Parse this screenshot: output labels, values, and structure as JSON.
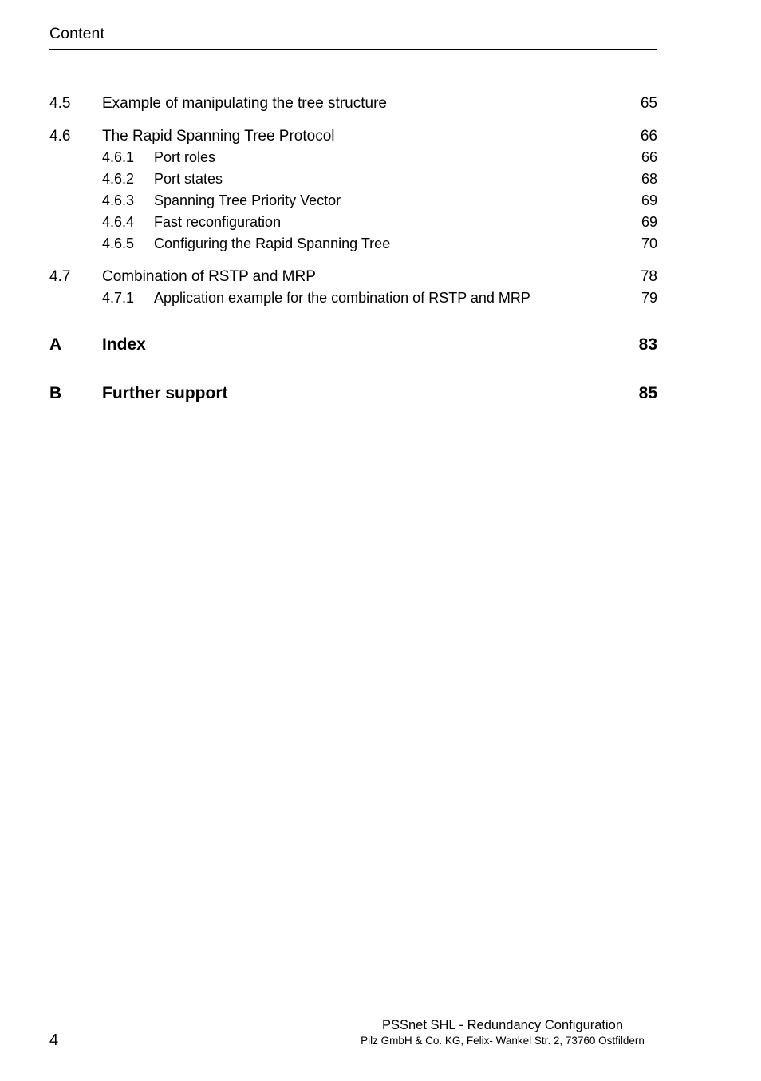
{
  "header": {
    "title": "Content"
  },
  "toc": {
    "entries": [
      {
        "level": 1,
        "number": "4.5",
        "title": "Example of manipulating the tree structure",
        "page": "65"
      },
      {
        "level": 1,
        "number": "4.6",
        "title": "The Rapid Spanning Tree Protocol",
        "page": "66"
      },
      {
        "level": 2,
        "number": "4.6.1",
        "title": "Port roles",
        "page": "66"
      },
      {
        "level": 2,
        "number": "4.6.2",
        "title": "Port states",
        "page": "68"
      },
      {
        "level": 2,
        "number": "4.6.3",
        "title": "Spanning Tree Priority Vector",
        "page": "69"
      },
      {
        "level": 2,
        "number": "4.6.4",
        "title": "Fast reconfiguration",
        "page": "69"
      },
      {
        "level": 2,
        "number": "4.6.5",
        "title": "Configuring the Rapid Spanning Tree",
        "page": "70"
      },
      {
        "level": 1,
        "number": "4.7",
        "title": "Combination of RSTP and MRP",
        "page": "78"
      },
      {
        "level": 2,
        "number": "4.7.1",
        "title": "Application example for the combination of RSTP and MRP",
        "page": "79"
      },
      {
        "level": 0,
        "number": "A",
        "title": "Index",
        "page": "83"
      },
      {
        "level": 0,
        "number": "B",
        "title": "Further support",
        "page": "85"
      }
    ]
  },
  "footer": {
    "page_number": "4",
    "document_title": "PSSnet SHL - Redundancy Configuration",
    "company_address": "Pilz GmbH & Co. KG, Felix- Wankel Str. 2, 73760 Ostfildern"
  },
  "colors": {
    "text": "#000000",
    "background": "#ffffff",
    "rule": "#000000"
  }
}
